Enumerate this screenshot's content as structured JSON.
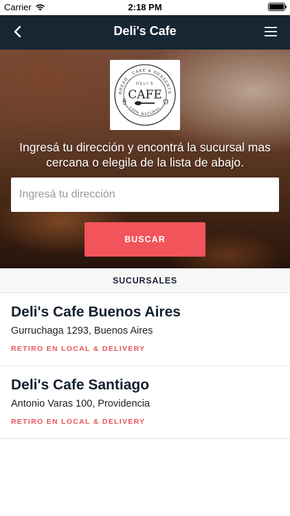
{
  "status_bar": {
    "carrier": "Carrier",
    "time": "2:18 PM"
  },
  "nav": {
    "title": "Deli's Cafe",
    "back_icon": "chevron-left-icon",
    "menu_icon": "hamburger-menu-icon"
  },
  "hero": {
    "logo_text": {
      "top": "DELI'S",
      "main": "CAFE",
      "ring_top": "BREAD · CAKE & DESSERTS",
      "ring_bottom": "100% NATURAL"
    },
    "instruction": "Ingresá tu dirección y encontrá la sucursal mas cercana o elegila de la lista de abajo.",
    "address_placeholder": "Ingresá tu dirección",
    "search_label": "BUSCAR"
  },
  "section": {
    "title": "SUCURSALES"
  },
  "branches": [
    {
      "name": "Deli's Cafe Buenos Aires",
      "address": "Gurruchaga 1293, Buenos Aires",
      "service": "RETIRO EN LOCAL & DELIVERY"
    },
    {
      "name": "Deli's Cafe Santiago",
      "address": "Antonio Varas 100, Providencia",
      "service": "RETIRO EN LOCAL & DELIVERY"
    }
  ],
  "colors": {
    "nav_bg": "#162633",
    "accent": "#f2545b",
    "tag": "#e9535a"
  }
}
